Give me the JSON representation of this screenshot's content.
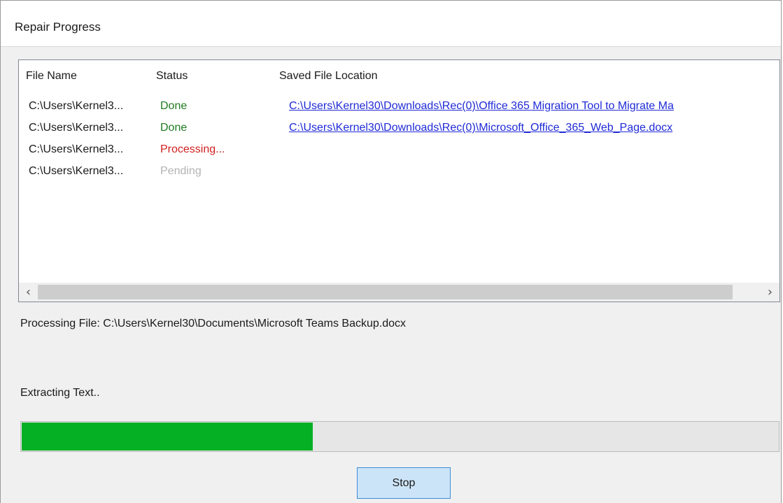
{
  "window": {
    "title": "Repair Progress"
  },
  "list": {
    "columns": [
      "File Name",
      "Status",
      "Saved File Location"
    ],
    "rows": [
      {
        "name": "C:\\Users\\Kernel3...",
        "status": "Done",
        "status_kind": "done",
        "location": "C:\\Users\\Kernel30\\Downloads\\Rec(0)\\Office 365 Migration Tool to Migrate Ma"
      },
      {
        "name": "C:\\Users\\Kernel3...",
        "status": "Done",
        "status_kind": "done",
        "location": "C:\\Users\\Kernel30\\Downloads\\Rec(0)\\Microsoft_Office_365_Web_Page.docx"
      },
      {
        "name": "C:\\Users\\Kernel3...",
        "status": "Processing...",
        "status_kind": "processing",
        "location": ""
      },
      {
        "name": "C:\\Users\\Kernel3...",
        "status": "Pending",
        "status_kind": "pending",
        "location": ""
      }
    ],
    "scroll_left_icon": "chevron-left-icon",
    "scroll_right_icon": "chevron-right-icon"
  },
  "processing_file": "Processing File: C:\\Users\\Kernel30\\Documents\\Microsoft Teams Backup.docx",
  "extracting_label": "Extracting Text..",
  "progress": {
    "fraction": 0.385,
    "fill_color": "#06b025"
  },
  "buttons": {
    "stop": "Stop"
  },
  "colors": {
    "done": "#1f7a1f",
    "processing": "#d21f1f",
    "pending": "#b3b3b3",
    "link": "#1f2ad6",
    "button_bg": "#cce4f7",
    "button_border": "#3c8dd6"
  }
}
